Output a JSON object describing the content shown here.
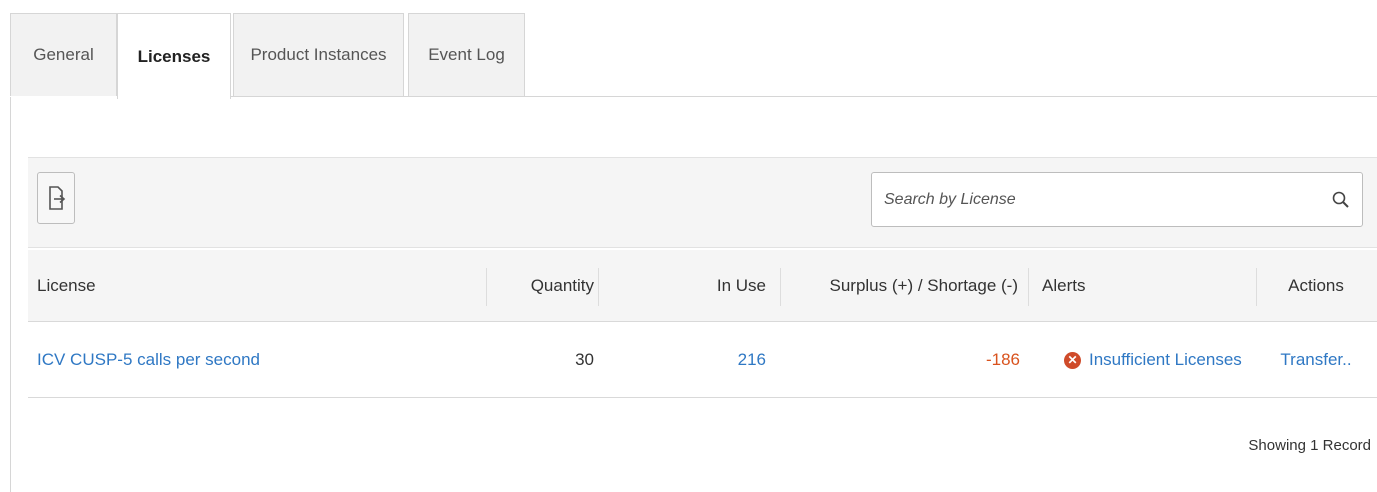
{
  "tabs": [
    {
      "label": "General",
      "active": false
    },
    {
      "label": "Licenses",
      "active": true
    },
    {
      "label": "Product Instances",
      "active": false
    },
    {
      "label": "Event Log",
      "active": false
    }
  ],
  "toolbar": {
    "export_icon": "export-icon",
    "search": {
      "placeholder": "Search by License",
      "value": "",
      "icon": "search-icon"
    }
  },
  "table": {
    "columns": [
      "License",
      "Quantity",
      "In Use",
      "Surplus (+) / Shortage (-)",
      "Alerts",
      "Actions"
    ],
    "rows": [
      {
        "license": "ICV CUSP-5 calls per second",
        "quantity": "30",
        "in_use": "216",
        "surplus": "-186",
        "alert": "Insufficient Licenses",
        "alert_icon": "error-icon",
        "action": "Transfer.."
      }
    ]
  },
  "footer": {
    "record_count": "Showing 1 Record"
  },
  "colors": {
    "link": "#2f78c4",
    "negative": "#d9531e",
    "alert": "#cf4b2a"
  }
}
